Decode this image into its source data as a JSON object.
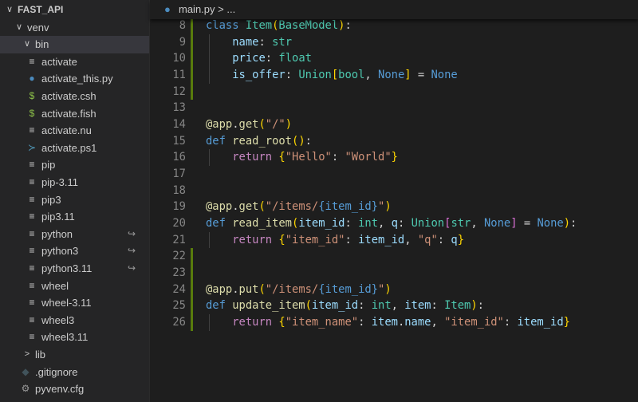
{
  "explorer": {
    "items": [
      {
        "label": "FAST_API",
        "kind": "root",
        "chevron": "∨"
      },
      {
        "label": "venv",
        "kind": "folder",
        "chevron": "∨"
      },
      {
        "label": "bin",
        "kind": "folder-open",
        "chevron": "∨",
        "selected": true
      },
      {
        "label": "activate",
        "icon": "lines-icon"
      },
      {
        "label": "activate_this.py",
        "icon": "python-icon"
      },
      {
        "label": "activate.csh",
        "icon": "dollar-icon"
      },
      {
        "label": "activate.fish",
        "icon": "dollar-icon"
      },
      {
        "label": "activate.nu",
        "icon": "lines-icon"
      },
      {
        "label": "activate.ps1",
        "icon": "powershell-icon"
      },
      {
        "label": "pip",
        "icon": "lines-icon"
      },
      {
        "label": "pip-3.11",
        "icon": "lines-icon"
      },
      {
        "label": "pip3",
        "icon": "lines-icon"
      },
      {
        "label": "pip3.11",
        "icon": "lines-icon"
      },
      {
        "label": "python",
        "icon": "lines-icon",
        "symlink": true
      },
      {
        "label": "python3",
        "icon": "lines-icon",
        "symlink": true
      },
      {
        "label": "python3.11",
        "icon": "lines-icon",
        "symlink": true
      },
      {
        "label": "wheel",
        "icon": "lines-icon"
      },
      {
        "label": "wheel-3.11",
        "icon": "lines-icon"
      },
      {
        "label": "wheel3",
        "icon": "lines-icon"
      },
      {
        "label": "wheel3.11",
        "icon": "lines-icon"
      },
      {
        "label": "lib",
        "kind": "folder-closed",
        "chevron": ">"
      },
      {
        "label": ".gitignore",
        "icon": "git-icon",
        "top": true
      },
      {
        "label": "pyvenv.cfg",
        "icon": "gear-icon",
        "top": true
      }
    ]
  },
  "breadcrumb": {
    "file": "main.py",
    "rest": " > ..."
  },
  "code": [
    {
      "n": "8",
      "t": [
        [
          "class",
          "kw"
        ],
        [
          " "
        ],
        [
          "Item",
          "ty"
        ],
        [
          "(",
          "b1"
        ],
        [
          "BaseModel",
          "ty"
        ],
        [
          ")",
          "b1"
        ],
        [
          ":"
        ]
      ]
    },
    {
      "n": "9",
      "t": [
        [
          "    "
        ],
        [
          "name",
          "var"
        ],
        [
          ": "
        ],
        [
          "str",
          "ty"
        ]
      ]
    },
    {
      "n": "10",
      "t": [
        [
          "    "
        ],
        [
          "price",
          "var"
        ],
        [
          ": "
        ],
        [
          "float",
          "ty"
        ]
      ]
    },
    {
      "n": "11",
      "t": [
        [
          "    "
        ],
        [
          "is_offer",
          "var"
        ],
        [
          ": "
        ],
        [
          "Union",
          "ty"
        ],
        [
          "[",
          "b1"
        ],
        [
          "bool",
          "ty"
        ],
        [
          ", "
        ],
        [
          "None",
          "kw"
        ],
        [
          "]",
          "b1"
        ],
        [
          " = "
        ],
        [
          "None",
          "kw"
        ]
      ]
    },
    {
      "n": "12",
      "t": []
    },
    {
      "n": "13",
      "t": []
    },
    {
      "n": "14",
      "t": [
        [
          "@app",
          "fn"
        ],
        [
          "."
        ],
        [
          "get",
          "fn"
        ],
        [
          "(",
          "b1"
        ],
        [
          "\"/\"",
          "str"
        ],
        [
          ")",
          "b1"
        ]
      ]
    },
    {
      "n": "15",
      "t": [
        [
          "def",
          "kw"
        ],
        [
          " "
        ],
        [
          "read_root",
          "fn"
        ],
        [
          "(",
          "b1"
        ],
        [
          ")",
          "b1"
        ],
        [
          ":"
        ]
      ]
    },
    {
      "n": "16",
      "t": [
        [
          "    "
        ],
        [
          "return",
          "ctl"
        ],
        [
          " "
        ],
        [
          "{",
          "b1"
        ],
        [
          "\"Hello\"",
          "str"
        ],
        [
          ": "
        ],
        [
          "\"World\"",
          "str"
        ],
        [
          "}",
          "b1"
        ]
      ]
    },
    {
      "n": "17",
      "t": []
    },
    {
      "n": "18",
      "t": []
    },
    {
      "n": "19",
      "t": [
        [
          "@app",
          "fn"
        ],
        [
          "."
        ],
        [
          "get",
          "fn"
        ],
        [
          "(",
          "b1"
        ],
        [
          "\"/items/",
          "str"
        ],
        [
          "{item_id}",
          "kw"
        ],
        [
          "\"",
          "str"
        ],
        [
          ")",
          "b1"
        ]
      ]
    },
    {
      "n": "20",
      "t": [
        [
          "def",
          "kw"
        ],
        [
          " "
        ],
        [
          "read_item",
          "fn"
        ],
        [
          "(",
          "b1"
        ],
        [
          "item_id",
          "var"
        ],
        [
          ": "
        ],
        [
          "int",
          "ty"
        ],
        [
          ", "
        ],
        [
          "q",
          "var"
        ],
        [
          ": "
        ],
        [
          "Union",
          "ty"
        ],
        [
          "[",
          "b2"
        ],
        [
          "str",
          "ty"
        ],
        [
          ", "
        ],
        [
          "None",
          "kw"
        ],
        [
          "]",
          "b2"
        ],
        [
          " = "
        ],
        [
          "None",
          "kw"
        ],
        [
          ")",
          "b1"
        ],
        [
          ":"
        ]
      ]
    },
    {
      "n": "21",
      "t": [
        [
          "    "
        ],
        [
          "return",
          "ctl"
        ],
        [
          " "
        ],
        [
          "{",
          "b1"
        ],
        [
          "\"item_id\"",
          "str"
        ],
        [
          ": "
        ],
        [
          "item_id",
          "var"
        ],
        [
          ", "
        ],
        [
          "\"q\"",
          "str"
        ],
        [
          ": "
        ],
        [
          "q",
          "var"
        ],
        [
          "}",
          "b1"
        ]
      ]
    },
    {
      "n": "22",
      "t": []
    },
    {
      "n": "23",
      "t": []
    },
    {
      "n": "24",
      "t": [
        [
          "@app",
          "fn"
        ],
        [
          "."
        ],
        [
          "put",
          "fn"
        ],
        [
          "(",
          "b1"
        ],
        [
          "\"/items/",
          "str"
        ],
        [
          "{item_id}",
          "kw"
        ],
        [
          "\"",
          "str"
        ],
        [
          ")",
          "b1"
        ]
      ]
    },
    {
      "n": "25",
      "t": [
        [
          "def",
          "kw"
        ],
        [
          " "
        ],
        [
          "update_item",
          "fn"
        ],
        [
          "(",
          "b1"
        ],
        [
          "item_id",
          "var"
        ],
        [
          ": "
        ],
        [
          "int",
          "ty"
        ],
        [
          ", "
        ],
        [
          "item",
          "var"
        ],
        [
          ": "
        ],
        [
          "Item",
          "ty"
        ],
        [
          ")",
          "b1"
        ],
        [
          ":"
        ]
      ]
    },
    {
      "n": "26",
      "t": [
        [
          "    "
        ],
        [
          "return",
          "ctl"
        ],
        [
          " "
        ],
        [
          "{",
          "b1"
        ],
        [
          "\"item_name\"",
          "str"
        ],
        [
          ": "
        ],
        [
          "item",
          "var"
        ],
        [
          "."
        ],
        [
          "name",
          "var"
        ],
        [
          ", "
        ],
        [
          "\"item_id\"",
          "str"
        ],
        [
          ": "
        ],
        [
          "item_id",
          "var"
        ],
        [
          "}",
          "b1"
        ]
      ]
    }
  ],
  "colors": {
    "modified_gutter": "#587c0c",
    "selection": "#37373d"
  }
}
